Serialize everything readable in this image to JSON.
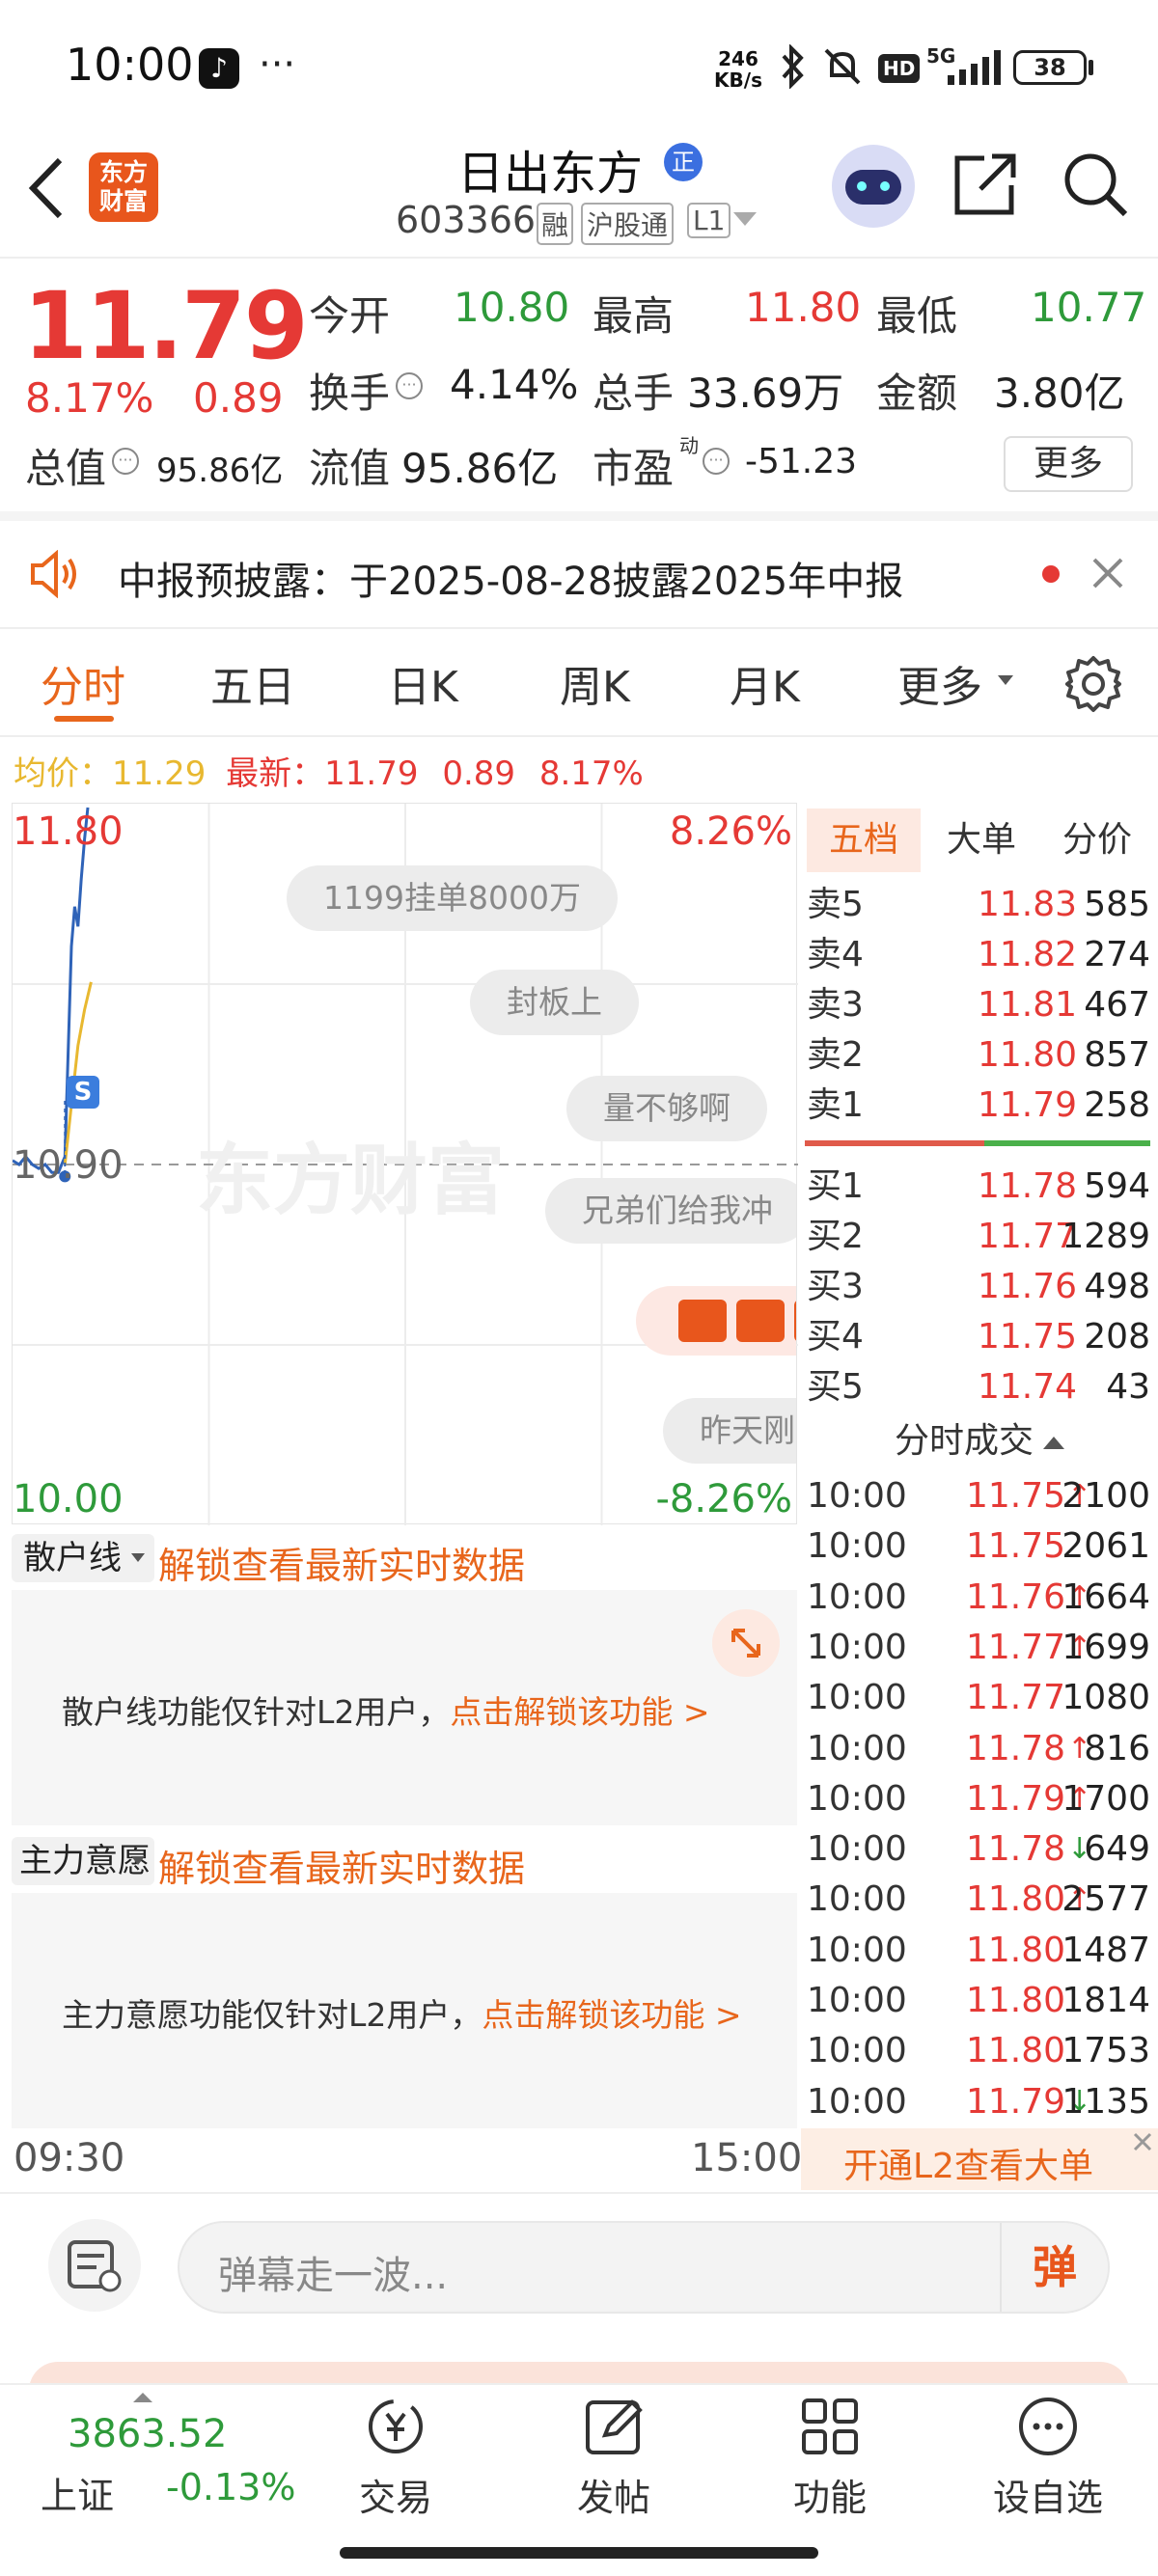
{
  "status_bar": {
    "time": "10:00",
    "dots": "···",
    "net_speed_top": "246",
    "net_speed_bottom": "KB/s",
    "hd": "HD",
    "signal": "5G",
    "battery": "38"
  },
  "header": {
    "logo_line1": "东方",
    "logo_line2": "财富",
    "stock_name": "日出东方",
    "badge_zheng": "正",
    "stock_code": "603366",
    "tag_rong": "融",
    "tag_hgt": "沪股通",
    "tag_l1": "L1"
  },
  "quote": {
    "price": "11.79",
    "change_pct": "8.17%",
    "change": "0.89",
    "open_label": "今开",
    "open": "10.80",
    "high_label": "最高",
    "high": "11.80",
    "low_label": "最低",
    "low": "10.77",
    "turnover_label": "换手",
    "turnover": "4.14%",
    "volume_label": "总手",
    "volume": "33.69万",
    "amount_label": "金额",
    "amount": "3.80亿",
    "mcap_label": "总值",
    "mcap": "95.86亿",
    "float_label": "流值",
    "float": "95.86亿",
    "pe_label": "市盈",
    "pe_sup": "动",
    "pe": "-51.23",
    "more": "更多"
  },
  "notice": {
    "text": "中报预披露：于2025-08-28披露2025年中报"
  },
  "tabs": [
    "分时",
    "五日",
    "日K",
    "周K",
    "月K",
    "更多"
  ],
  "chart_info": {
    "avg_label": "均价：",
    "avg": "11.29",
    "latest_label": "最新：",
    "latest": "11.79",
    "change": "0.89",
    "change_pct": "8.17%"
  },
  "chart_data": {
    "type": "line",
    "x_start": "09:30",
    "x_end": "15:00",
    "y_top": "11.80",
    "y_mid": "10.90",
    "y_bottom": "10.00",
    "pct_top": "8.26%",
    "pct_bottom": "-8.26%",
    "ylim": [
      10.0,
      11.8
    ],
    "series": [
      {
        "values": [
          [
            0,
            10.91
          ],
          [
            2,
            10.9
          ],
          [
            4,
            10.92
          ],
          [
            6,
            10.9
          ],
          [
            8,
            10.89
          ],
          [
            10,
            10.9
          ],
          [
            12,
            10.88
          ],
          [
            14,
            10.88
          ],
          [
            16,
            10.92
          ],
          [
            18,
            11.45
          ],
          [
            19,
            11.55
          ],
          [
            20,
            11.5
          ],
          [
            21,
            11.62
          ],
          [
            22,
            11.72
          ],
          [
            23,
            11.8
          ]
        ]
      },
      {
        "values": [
          [
            16,
            10.9
          ],
          [
            18,
            11.05
          ],
          [
            20,
            11.2
          ],
          [
            22,
            11.29
          ],
          [
            24,
            11.36
          ]
        ]
      }
    ],
    "marker": "S",
    "watermark": "东方财富"
  },
  "danmaku": [
    "1199挂单8000万",
    "封板上",
    "量不够啊",
    "兄弟们给我冲",
    "昨天刚"
  ],
  "panels": {
    "sanhu_select": "散户线",
    "zhuli_select": "主力意愿",
    "unlock_text": "解锁查看最新实时数据",
    "sanhu_msg": "散户线功能仅针对L2用户，",
    "zhuli_msg": "主力意愿功能仅针对L2用户，",
    "unlock_link": "点击解锁该功能 >"
  },
  "orderbook": {
    "tabs": [
      "五档",
      "大单",
      "分价"
    ],
    "asks": [
      {
        "label": "卖5",
        "price": "11.83",
        "vol": "585"
      },
      {
        "label": "卖4",
        "price": "11.82",
        "vol": "274"
      },
      {
        "label": "卖3",
        "price": "11.81",
        "vol": "467"
      },
      {
        "label": "卖2",
        "price": "11.80",
        "vol": "857"
      },
      {
        "label": "卖1",
        "price": "11.79",
        "vol": "258"
      }
    ],
    "bids": [
      {
        "label": "买1",
        "price": "11.78",
        "vol": "594"
      },
      {
        "label": "买2",
        "price": "11.77",
        "vol": "1289"
      },
      {
        "label": "买3",
        "price": "11.76",
        "vol": "498"
      },
      {
        "label": "买4",
        "price": "11.75",
        "vol": "208"
      },
      {
        "label": "买5",
        "price": "11.74",
        "vol": "43"
      }
    ]
  },
  "ticks": {
    "title": "分时成交",
    "rows": [
      {
        "time": "10:00",
        "price": "11.75",
        "dir": "↑",
        "vol": "2100"
      },
      {
        "time": "10:00",
        "price": "11.75",
        "dir": "",
        "vol": "2061"
      },
      {
        "time": "10:00",
        "price": "11.76",
        "dir": "↑",
        "vol": "1664"
      },
      {
        "time": "10:00",
        "price": "11.77",
        "dir": "↑",
        "vol": "1699"
      },
      {
        "time": "10:00",
        "price": "11.77",
        "dir": "",
        "vol": "1080"
      },
      {
        "time": "10:00",
        "price": "11.78",
        "dir": "↑",
        "vol": "816"
      },
      {
        "time": "10:00",
        "price": "11.79",
        "dir": "↑",
        "vol": "1700"
      },
      {
        "time": "10:00",
        "price": "11.78",
        "dir": "↓",
        "vol": "649"
      },
      {
        "time": "10:00",
        "price": "11.80",
        "dir": "↑",
        "vol": "2577"
      },
      {
        "time": "10:00",
        "price": "11.80",
        "dir": "",
        "vol": "1487"
      },
      {
        "time": "10:00",
        "price": "11.80",
        "dir": "",
        "vol": "1814"
      },
      {
        "time": "10:00",
        "price": "11.80",
        "dir": "",
        "vol": "1753"
      },
      {
        "time": "10:00",
        "price": "11.79",
        "dir": "↓",
        "vol": "1135"
      }
    ],
    "promo": "开通L2查看大单"
  },
  "comment": {
    "placeholder": "弹幕走一波...",
    "send": "弹"
  },
  "bottom_nav": {
    "index_value": "3863.52",
    "index_name": "上证",
    "index_change": "-0.13%",
    "items": [
      "交易",
      "发帖",
      "功能",
      "设自选"
    ]
  },
  "colors": {
    "up": "#e53935",
    "down": "#2e9a3a",
    "accent": "#e8661c",
    "price_line": "#2f63b8",
    "avg_line": "#e8b830"
  }
}
